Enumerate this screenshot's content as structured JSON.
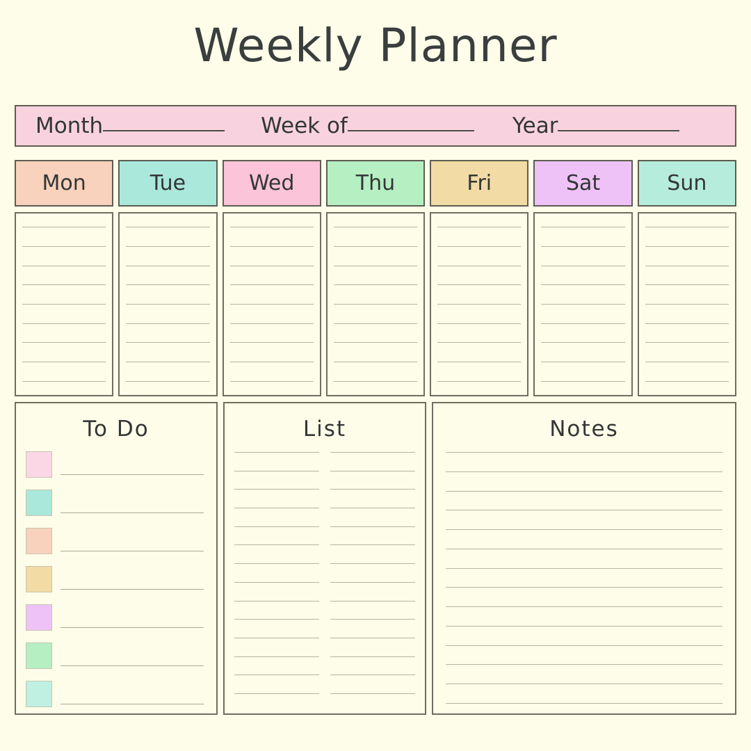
{
  "page": {
    "title": "Weekly Planner",
    "background_color": "#fdfde9",
    "ink_color": "#3a3e3e",
    "border_color": "#6e6e61",
    "rule_color": "#b3b3a2"
  },
  "meta_bar": {
    "background_color": "#f8d3df",
    "fields": [
      {
        "label": "Month",
        "value": "",
        "blank_rule": true
      },
      {
        "label": "Week of",
        "value": "",
        "blank_rule": true
      },
      {
        "label": "Year",
        "value": "",
        "blank_rule": true
      }
    ]
  },
  "days": [
    {
      "label": "Mon",
      "color": "#f8d2bc",
      "lines": 9
    },
    {
      "label": "Tue",
      "color": "#a9e8da",
      "lines": 9
    },
    {
      "label": "Wed",
      "color": "#fbc4d8",
      "lines": 9
    },
    {
      "label": "Thu",
      "color": "#b5efc2",
      "lines": 9
    },
    {
      "label": "Fri",
      "color": "#f2dba4",
      "lines": 9
    },
    {
      "label": "Sat",
      "color": "#eec2f7",
      "lines": 9
    },
    {
      "label": "Sun",
      "color": "#b6ecdc",
      "lines": 9
    }
  ],
  "todo": {
    "title": "To  Do",
    "checkbox_colors": [
      "#fbd7e6",
      "#a9e8da",
      "#f8d2bc",
      "#f2dba4",
      "#eec2f7",
      "#b5efc2",
      "#bff0e2"
    ],
    "item_count": 7
  },
  "list": {
    "title": "List",
    "columns": 2,
    "lines_per_column": 14
  },
  "notes": {
    "title": "Notes",
    "lines": 14
  }
}
